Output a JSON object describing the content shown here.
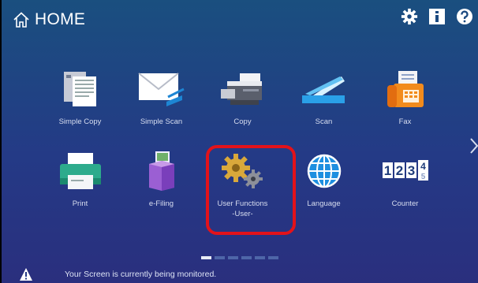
{
  "header": {
    "title": "HOME",
    "icons": [
      "settings-icon",
      "info-icon",
      "help-icon"
    ]
  },
  "apps": {
    "row1": [
      {
        "label": "Simple Copy",
        "icon": "simple-copy-icon"
      },
      {
        "label": "Simple Scan",
        "icon": "simple-scan-icon"
      },
      {
        "label": "Copy",
        "icon": "copy-icon"
      },
      {
        "label": "Scan",
        "icon": "scan-icon"
      },
      {
        "label": "Fax",
        "icon": "fax-icon"
      }
    ],
    "row2": [
      {
        "label": "Print",
        "icon": "print-icon"
      },
      {
        "label": "e-Filing",
        "icon": "e-filing-icon"
      },
      {
        "label": "User Functions\n-User-",
        "icon": "user-functions-icon"
      },
      {
        "label": "Language",
        "icon": "language-icon"
      },
      {
        "label": "Counter",
        "icon": "counter-icon"
      }
    ]
  },
  "counter_digits": [
    "1",
    "2",
    "3",
    "4"
  ],
  "pagination": {
    "pages": 6,
    "current": 1
  },
  "status": {
    "message": "Your Screen is currently being monitored."
  },
  "colors": {
    "highlight": "#e3121a",
    "background": "#243a86"
  }
}
